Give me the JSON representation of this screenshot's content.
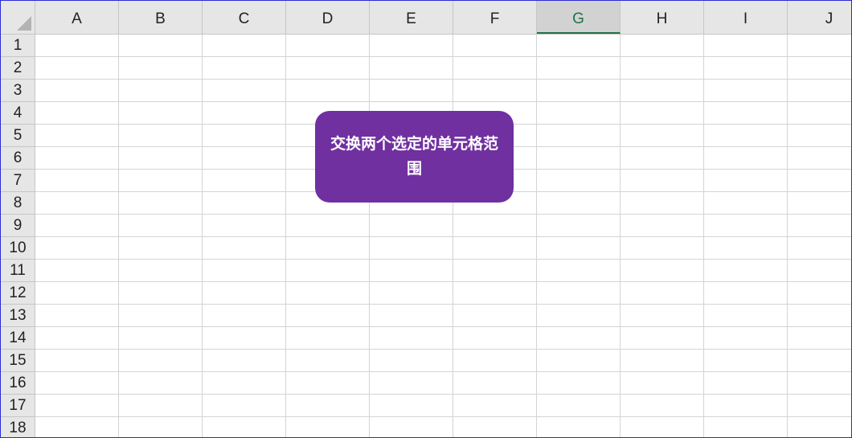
{
  "sheet": {
    "columns": [
      "A",
      "B",
      "C",
      "D",
      "E",
      "F",
      "G",
      "H",
      "I",
      "J"
    ],
    "rows": [
      "1",
      "2",
      "3",
      "4",
      "5",
      "6",
      "7",
      "8",
      "9",
      "10",
      "11",
      "12",
      "13",
      "14",
      "15",
      "16",
      "17",
      "18"
    ],
    "selected_column": "G"
  },
  "callout": {
    "text": "交换两个选定的单元格范围"
  },
  "colors": {
    "callout_fill": "#7030a0",
    "callout_text": "#ffffff",
    "header_bg": "#e6e6e6",
    "selected_header_accent": "#217346",
    "gridline": "#d4d4d4",
    "window_border": "#2b2bd6"
  }
}
